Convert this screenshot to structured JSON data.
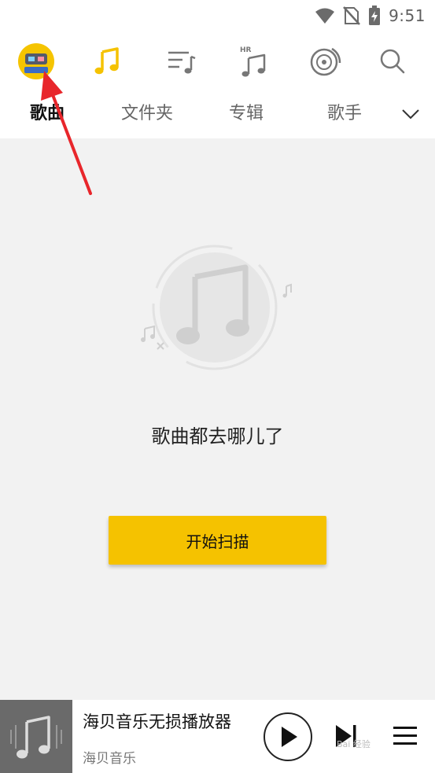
{
  "status_bar": {
    "time": "9:51"
  },
  "top_nav": {
    "icons": [
      "avatar",
      "music-note-icon",
      "playlist-icon",
      "hr-music-icon",
      "vinyl-icon",
      "search-icon"
    ],
    "hr_label": "HR"
  },
  "sub_tabs": {
    "items": [
      "歌曲",
      "文件夹",
      "专辑",
      "歌手"
    ],
    "active": "歌曲"
  },
  "empty_state": {
    "message": "歌曲都去哪儿了"
  },
  "scan_button": {
    "label": "开始扫描"
  },
  "mini_player": {
    "title": "海贝音乐无损播放器",
    "subtitle": "海贝音乐"
  },
  "watermark": {
    "text": "Bai 经验"
  },
  "colors": {
    "accent": "#f5c200",
    "background": "#f2f2f2",
    "annotation_arrow": "#e8262b"
  }
}
